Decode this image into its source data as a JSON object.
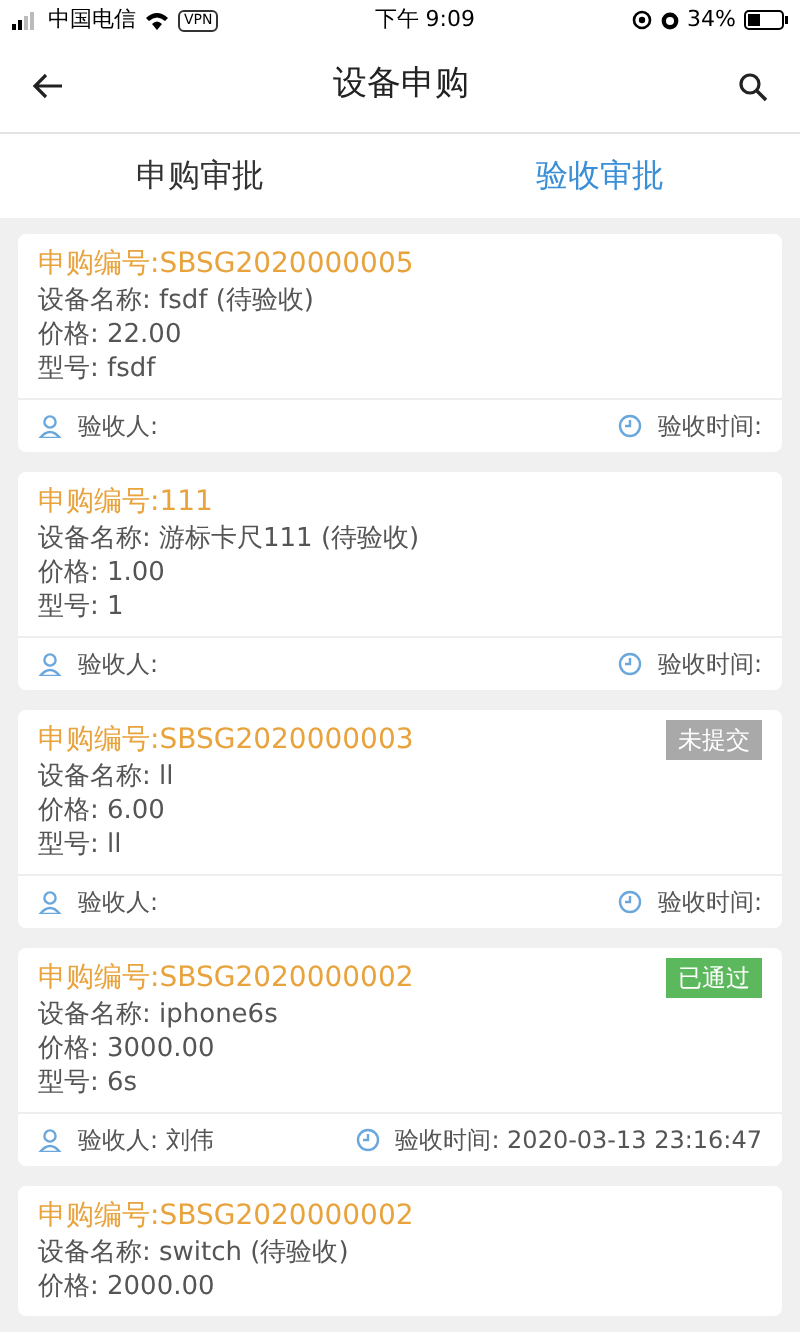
{
  "status_bar": {
    "carrier": "中国电信",
    "vpn": "VPN",
    "time": "下午 9:09",
    "battery": "34%"
  },
  "header": {
    "title": "设备申购"
  },
  "tabs": [
    {
      "label": "申购审批",
      "selected": false
    },
    {
      "label": "验收审批",
      "selected": true
    }
  ],
  "cards": [
    {
      "code": "申购编号:SBSG2020000005",
      "lines": [
        "设备名称: fsdf (待验收)",
        "价格: 22.00",
        "型号: fsdf"
      ],
      "receiver": "验收人:",
      "time": "验收时间:"
    },
    {
      "code": "申购编号:111",
      "lines": [
        "设备名称: 游标卡尺111 (待验收)",
        "价格: 1.00",
        "型号: 1"
      ],
      "receiver": "验收人:",
      "time": "验收时间:"
    },
    {
      "code": "申购编号:SBSG2020000003",
      "status": {
        "kind": "unsubmitted",
        "label": "未提交"
      },
      "lines": [
        "设备名称: ll",
        "价格: 6.00",
        "型号: ll"
      ],
      "receiver": "验收人:",
      "time": "验收时间:"
    },
    {
      "code": "申购编号:SBSG2020000002",
      "status": {
        "kind": "approved",
        "label": "已通过"
      },
      "lines": [
        "设备名称: iphone6s",
        "价格: 3000.00",
        "型号: 6s"
      ],
      "receiver": "验收人: 刘伟",
      "time": "验收时间: 2020-03-13 23:16:47"
    },
    {
      "code": "申购编号:SBSG2020000002",
      "lines": [
        "设备名称: switch (待验收)",
        "价格: 2000.00"
      ]
    }
  ]
}
